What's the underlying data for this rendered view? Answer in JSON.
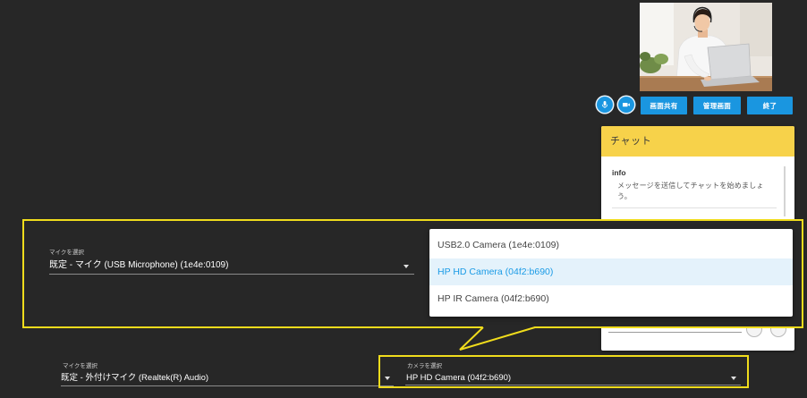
{
  "controls": {
    "mic_icon": "mic-icon",
    "camera_icon": "camera-icon",
    "screen_share": "画面共有",
    "admin_panel": "管理画面",
    "end": "終了"
  },
  "chat": {
    "title": "チャット",
    "message": {
      "sender": "info",
      "text": "メッセージを送信してチャットを始めましょう。"
    }
  },
  "callout": {
    "mic_select": {
      "label": "マイクを選択",
      "value": "既定 - マイク (USB Microphone) (1e4e:0109)"
    },
    "camera_menu": {
      "options": [
        {
          "label": "USB2.0 Camera (1e4e:0109)",
          "selected": false
        },
        {
          "label": "HP HD Camera (04f2:b690)",
          "selected": true
        },
        {
          "label": "HP IR Camera (04f2:b690)",
          "selected": false
        }
      ]
    }
  },
  "settings": {
    "mic_select": {
      "label": "マイクを選択",
      "value": "既定 - 外付けマイク (Realtek(R) Audio)"
    },
    "camera_select": {
      "label": "カメラを選択",
      "value": "HP HD Camera (04f2:b690)"
    }
  },
  "colors": {
    "background": "#272727",
    "accent_blue": "#1a96e0",
    "chat_header": "#f7d24a",
    "highlight_yellow": "#f0dc1c",
    "menu_highlight_bg": "#e4f2fb",
    "menu_highlight_text": "#1a9be6"
  }
}
